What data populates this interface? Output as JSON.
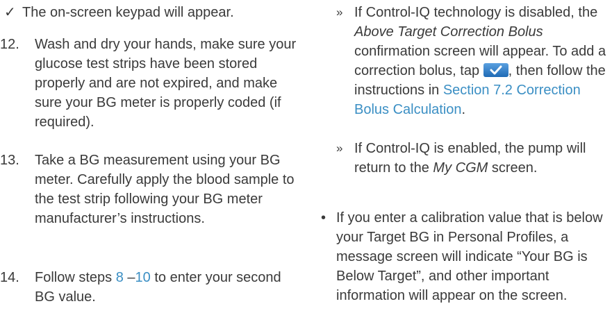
{
  "left": {
    "tick_item": {
      "marker": "✓",
      "text": "The on-screen keypad will appear."
    },
    "step12": {
      "number": "12.",
      "text": "Wash and dry your hands, make sure your glucose test strips have been stored properly and are not expired, and make sure your BG meter is properly coded (if required)."
    },
    "step13": {
      "number": "13.",
      "text": "Take a BG measurement using your BG meter. Carefully apply the blood sample to the test strip following your BG meter manufacturer’s instructions."
    },
    "step14": {
      "number": "14.",
      "text_before": "Follow steps ",
      "link1": "8",
      "dash": " –",
      "link2": "10",
      "text_after": " to enter your second BG value."
    }
  },
  "right": {
    "sub1": {
      "marker": "»",
      "text1": "If Control-IQ technology is disabled, the ",
      "em": "Above Target Correction Bolus",
      "text2": " confirmation screen will appear. To add a correction bolus, tap ",
      "text3": ", then follow the instructions in ",
      "link": "Section 7.2 Correction Bolus Calculation",
      "end": "."
    },
    "sub2": {
      "marker": "»",
      "text1": "If Control-IQ is enabled, the pump will return to the ",
      "em": "My CGM",
      "text2": " screen."
    },
    "bullet": {
      "marker": "•",
      "text": "If you enter a calibration value that is below your Target BG in Personal Profiles, a message screen will indicate “Your BG is Below Target”, and other important information will appear on the screen."
    }
  },
  "colors": {
    "text": "#3a3a3a",
    "link": "#3b8fc4",
    "button": "#2f7fcb"
  },
  "icons": {
    "confirm_button": "checkmark-icon"
  }
}
